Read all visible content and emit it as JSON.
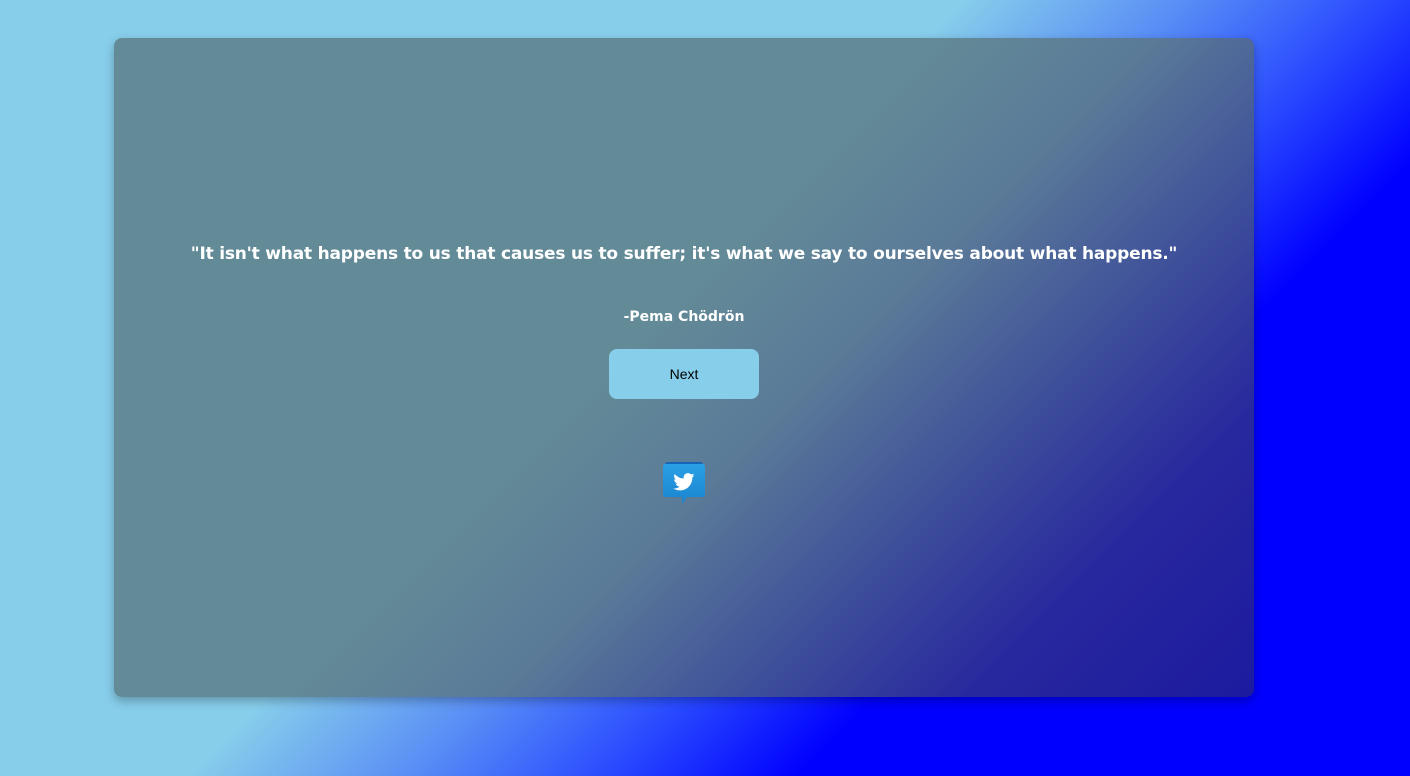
{
  "quote_box": {
    "quote_text": "\"It isn't what happens to us that causes us to suffer; it's what we say to ourselves about what happens.\"",
    "author_text": "-Pema Chödrön",
    "next_button_label": "Next",
    "tweet_icon": "twitter-bird-icon"
  },
  "colors": {
    "button_background": "#87ceeb",
    "text": "#ffffff",
    "page_gradient_start": "#87ceeb",
    "page_gradient_end": "#0000ff"
  }
}
